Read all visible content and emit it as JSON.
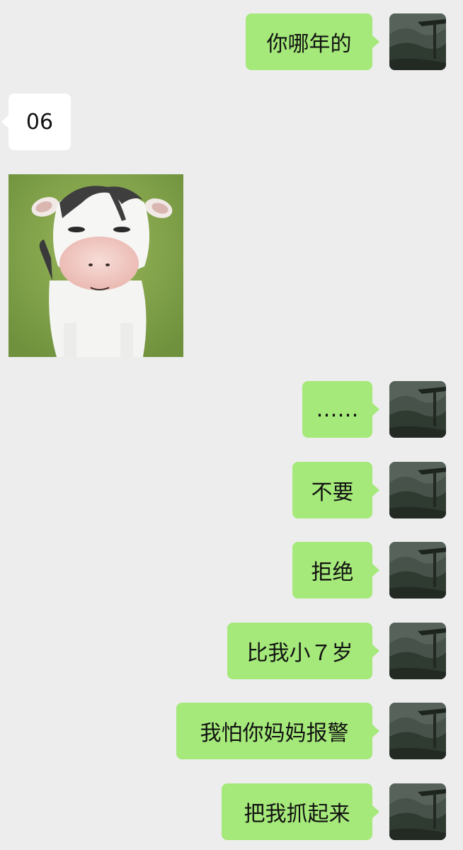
{
  "conversation": {
    "messages": [
      {
        "from": "me",
        "text": "你哪年的"
      },
      {
        "from": "other",
        "text": "06"
      },
      {
        "from": "other",
        "type": "sticker",
        "sticker": "cow-face-sticker"
      },
      {
        "from": "me",
        "text": "……"
      },
      {
        "from": "me",
        "text": "不要"
      },
      {
        "from": "me",
        "text": "拒绝"
      },
      {
        "from": "me",
        "text": "比我小７岁"
      },
      {
        "from": "me",
        "text": "我怕你妈妈报警"
      },
      {
        "from": "me",
        "text": "把我抓起来"
      }
    ]
  },
  "avatar": {
    "icon": "mountain-landscape-avatar"
  },
  "colors": {
    "background": "#ededed",
    "outgoing_bubble": "#a5e97a",
    "incoming_bubble": "#ffffff",
    "text": "#111111"
  }
}
